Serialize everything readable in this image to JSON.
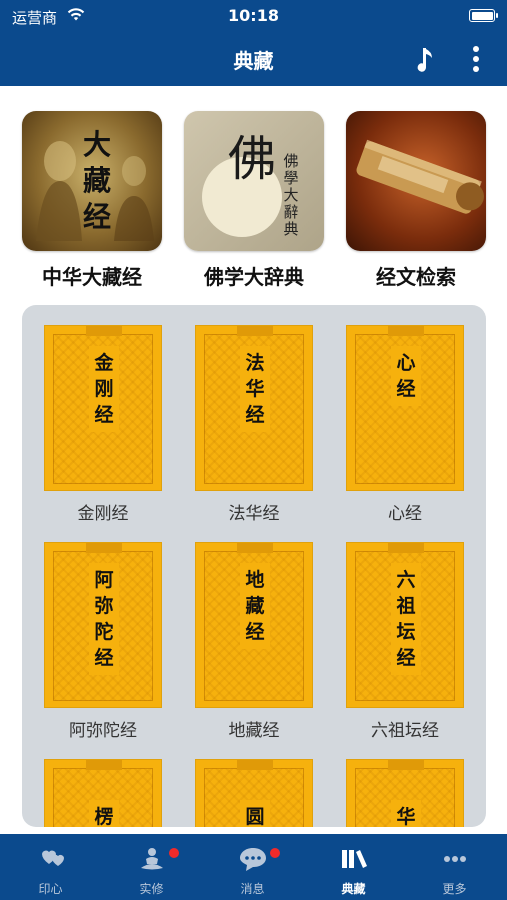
{
  "status": {
    "carrier": "运营商",
    "time": "10:18"
  },
  "header": {
    "title": "典藏"
  },
  "featured": [
    {
      "label": "中华大藏经",
      "art": "大\n藏\n经"
    },
    {
      "label": "佛学大辞典",
      "art_big": "佛",
      "art_small": "佛學大辭典"
    },
    {
      "label": "经文检索"
    }
  ],
  "books": [
    {
      "cover": "金\n刚\n经",
      "name": "金刚经"
    },
    {
      "cover": "法\n华\n经",
      "name": "法华经"
    },
    {
      "cover": "心\n经",
      "name": "心经"
    },
    {
      "cover": "阿\n弥\n陀\n经",
      "name": "阿弥陀经"
    },
    {
      "cover": "地\n藏\n经",
      "name": "地藏经"
    },
    {
      "cover": "六\n祖\n坛\n经",
      "name": "六祖坛经"
    },
    {
      "cover": "楞",
      "name": ""
    },
    {
      "cover": "圆",
      "name": ""
    },
    {
      "cover": "华",
      "name": ""
    }
  ],
  "tabs": [
    {
      "label": "印心",
      "icon": "heart-hands-icon"
    },
    {
      "label": "实修",
      "icon": "meditation-icon"
    },
    {
      "label": "消息",
      "icon": "chat-bubble-icon"
    },
    {
      "label": "典藏",
      "icon": "books-icon"
    },
    {
      "label": "更多",
      "icon": "ellipsis-icon"
    }
  ],
  "colors": {
    "primary": "#0b4a8d",
    "book": "#f6b10d",
    "badge": "#f02a2a",
    "panel": "#d3d8dd"
  }
}
